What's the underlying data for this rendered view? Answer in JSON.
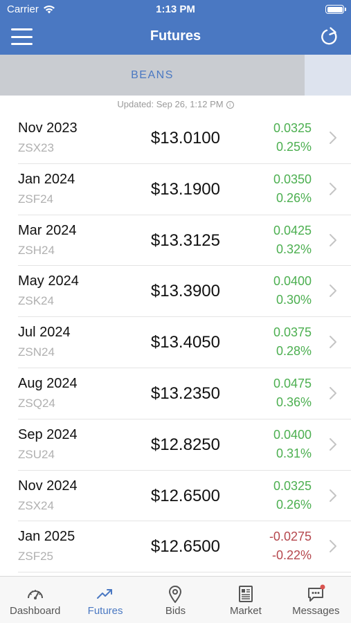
{
  "status_bar": {
    "carrier": "Carrier",
    "time": "1:13 PM"
  },
  "nav": {
    "title": "Futures",
    "menu_icon": "hamburger-icon",
    "refresh_icon": "refresh-icon"
  },
  "tabs": [
    {
      "label": "BEANS",
      "selected": true
    }
  ],
  "updated": "Updated: Sep 26, 1:12 PM",
  "colors": {
    "header": "#4a78c2",
    "positive": "#4caf50",
    "negative": "#b5474d",
    "active_tab": "#4a78c2"
  },
  "contracts": [
    {
      "month": "Nov 2023",
      "symbol": "ZSX23",
      "price": "$13.0100",
      "change": "0.0325",
      "pct": "0.25%",
      "direction": "up"
    },
    {
      "month": "Jan 2024",
      "symbol": "ZSF24",
      "price": "$13.1900",
      "change": "0.0350",
      "pct": "0.26%",
      "direction": "up"
    },
    {
      "month": "Mar 2024",
      "symbol": "ZSH24",
      "price": "$13.3125",
      "change": "0.0425",
      "pct": "0.32%",
      "direction": "up"
    },
    {
      "month": "May 2024",
      "symbol": "ZSK24",
      "price": "$13.3900",
      "change": "0.0400",
      "pct": "0.30%",
      "direction": "up"
    },
    {
      "month": "Jul 2024",
      "symbol": "ZSN24",
      "price": "$13.4050",
      "change": "0.0375",
      "pct": "0.28%",
      "direction": "up"
    },
    {
      "month": "Aug 2024",
      "symbol": "ZSQ24",
      "price": "$13.2350",
      "change": "0.0475",
      "pct": "0.36%",
      "direction": "up"
    },
    {
      "month": "Sep 2024",
      "symbol": "ZSU24",
      "price": "$12.8250",
      "change": "0.0400",
      "pct": "0.31%",
      "direction": "up"
    },
    {
      "month": "Nov 2024",
      "symbol": "ZSX24",
      "price": "$12.6500",
      "change": "0.0325",
      "pct": "0.26%",
      "direction": "up"
    },
    {
      "month": "Jan 2025",
      "symbol": "ZSF25",
      "price": "$12.6500",
      "change": "-0.0275",
      "pct": "-0.22%",
      "direction": "down"
    }
  ],
  "tabbar": [
    {
      "label": "Dashboard",
      "icon": "gauge-icon",
      "active": false
    },
    {
      "label": "Futures",
      "icon": "trend-up-icon",
      "active": true
    },
    {
      "label": "Bids",
      "icon": "map-pin-icon",
      "active": false
    },
    {
      "label": "Market",
      "icon": "newspaper-icon",
      "active": false
    },
    {
      "label": "Messages",
      "icon": "chat-bubble-icon",
      "active": false,
      "badge": true
    }
  ]
}
